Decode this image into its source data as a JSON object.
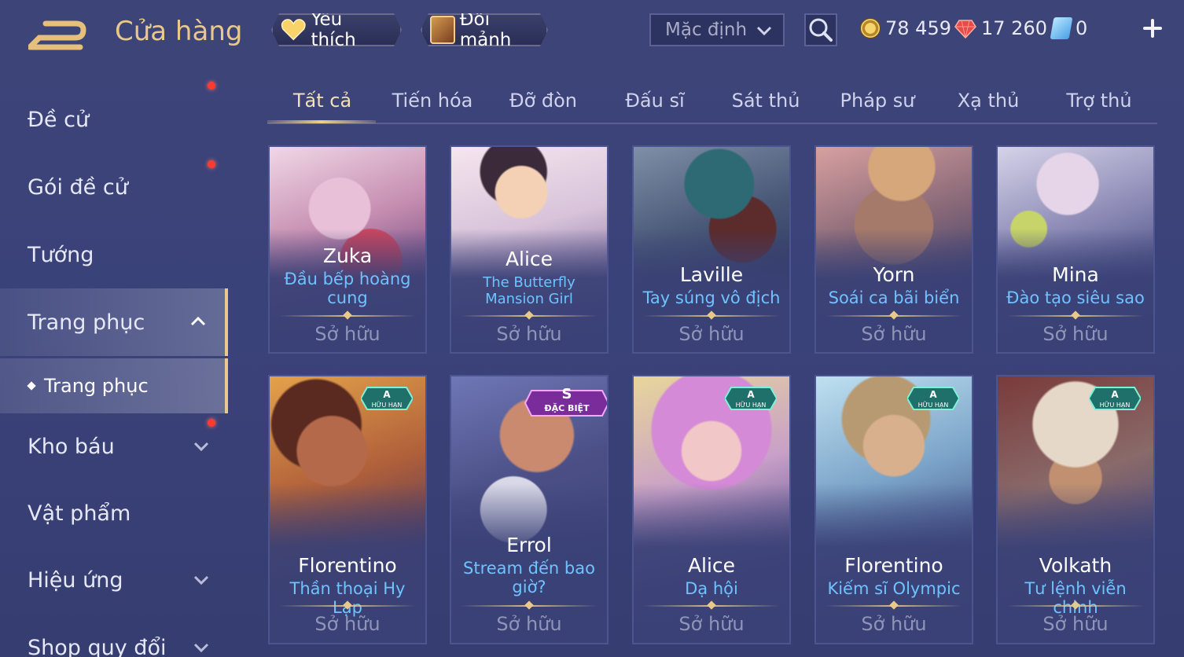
{
  "header": {
    "title": "Cửa hàng",
    "favorite_label": "Yêu thích",
    "fragment_label": "Đổi mảnh",
    "sort_label": "Mặc định",
    "currencies": [
      {
        "name": "gold",
        "value": "78 459"
      },
      {
        "name": "ruby",
        "value": "17 260"
      },
      {
        "name": "token",
        "value": "0"
      }
    ]
  },
  "sidebar": {
    "items": [
      {
        "label": "Đề cử"
      },
      {
        "label": "Gói đề cử"
      },
      {
        "label": "Tướng"
      },
      {
        "label": "Trang phục"
      },
      {
        "label": "Trang phục"
      },
      {
        "label": "Kho báu"
      },
      {
        "label": "Vật phẩm"
      },
      {
        "label": "Hiệu ứng"
      },
      {
        "label": "Shop quy đổi"
      }
    ]
  },
  "tabs": [
    {
      "label": "Tất cả"
    },
    {
      "label": "Tiến hóa"
    },
    {
      "label": "Đỡ đòn"
    },
    {
      "label": "Đấu sĩ"
    },
    {
      "label": "Sát thủ"
    },
    {
      "label": "Pháp sư"
    },
    {
      "label": "Xạ thủ"
    },
    {
      "label": "Trợ thủ"
    }
  ],
  "cards": [
    {
      "hero": "Zuka",
      "skin": "Đầu bếp hoàng cung",
      "status": "Sở hữu",
      "badge": ""
    },
    {
      "hero": "Alice",
      "skin": "The Butterfly Mansion Girl",
      "status": "Sở hữu",
      "badge": ""
    },
    {
      "hero": "Laville",
      "skin": "Tay súng vô địch",
      "status": "Sở hữu",
      "badge": ""
    },
    {
      "hero": "Yorn",
      "skin": "Soái ca bãi biển",
      "status": "Sở hữu",
      "badge": ""
    },
    {
      "hero": "Mina",
      "skin": "Đào tạo siêu sao",
      "status": "Sở hữu",
      "badge": ""
    },
    {
      "hero": "Florentino",
      "skin": "Thần thoại Hy Lạp",
      "status": "Sở hữu",
      "badge": "A",
      "badge_sub": "HỮU HẠN"
    },
    {
      "hero": "Errol",
      "skin": "Stream đến bao giờ?",
      "status": "Sở hữu",
      "badge": "S",
      "badge_sub": "ĐẶC BIỆT"
    },
    {
      "hero": "Alice",
      "skin": "Dạ hội",
      "status": "Sở hữu",
      "badge": "A",
      "badge_sub": "HỮU HẠN"
    },
    {
      "hero": "Florentino",
      "skin": "Kiếm sĩ Olympic",
      "status": "Sở hữu",
      "badge": "A",
      "badge_sub": "HỮU HẠN"
    },
    {
      "hero": "Volkath",
      "skin": "Tư lệnh viễn chinh",
      "status": "Sở hữu",
      "badge": "A",
      "badge_sub": "HỮU HẠN"
    }
  ],
  "colors": {
    "accent_gold": "#e8c98a",
    "skin_blue": "#6ec3ff",
    "background": "#3b4278"
  }
}
